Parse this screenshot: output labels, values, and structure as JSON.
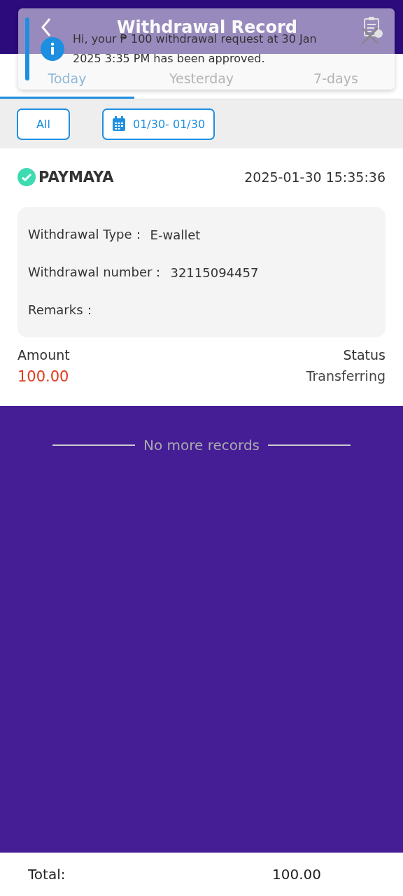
{
  "header": {
    "title": "Withdrawal Record"
  },
  "tabs": [
    {
      "label": "Today",
      "selected": true
    },
    {
      "label": "Yesterday",
      "selected": false
    },
    {
      "label": "7-days",
      "selected": false
    }
  ],
  "filters": {
    "type_button": "All",
    "date_range": "01/30- 01/30"
  },
  "record": {
    "provider": "PAYMAYA",
    "time": "2025-01-30 15:35:36",
    "details": [
      {
        "label": "Withdrawal Type：",
        "value": "E-wallet"
      },
      {
        "label": "Withdrawal number：",
        "value": "32115094457"
      },
      {
        "label": "Remarks："
      }
    ],
    "amount_label": "Amount",
    "amount": "100.00",
    "status_label": "Status",
    "status": "Transferring"
  },
  "end_message": "No more records",
  "footer": {
    "label": "Total:",
    "value": "100.00"
  },
  "notification": {
    "message": "Hi, your ₱ 100 withdrawal request at 30 Jan 2025 3:35 PM has been approved."
  }
}
